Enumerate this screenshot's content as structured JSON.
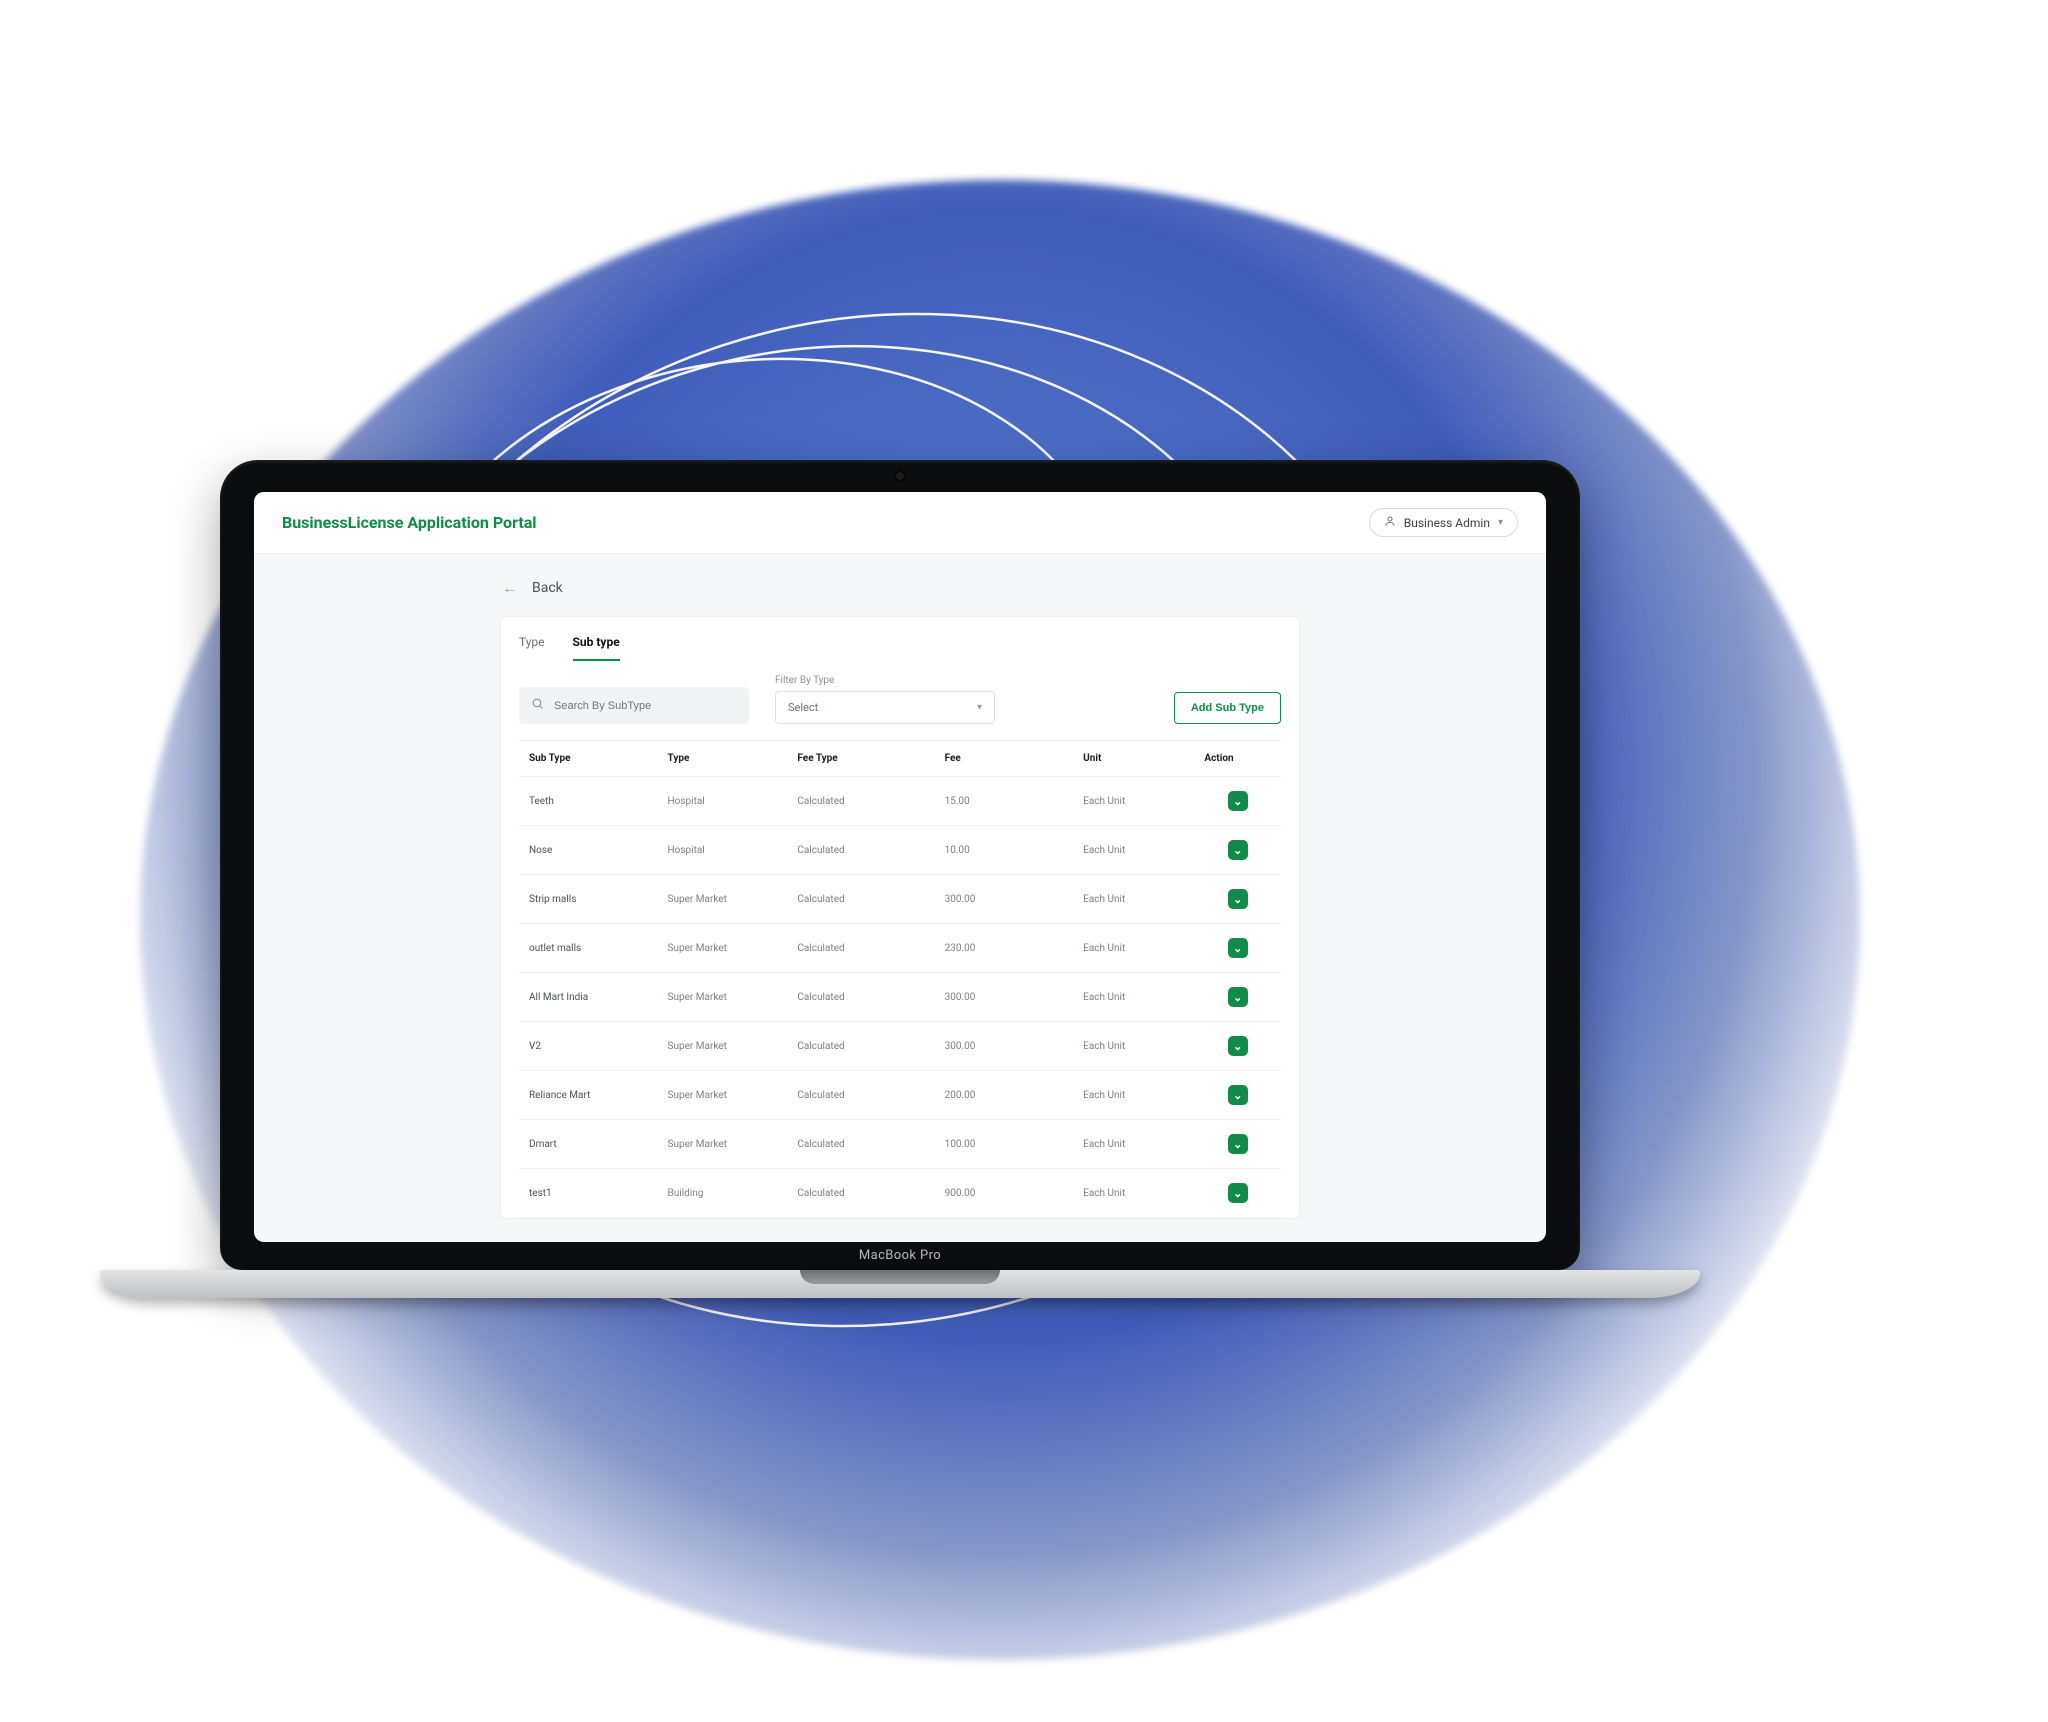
{
  "header": {
    "app_title": "BusinessLicense Application Portal",
    "user_label": "Business Admin"
  },
  "back_label": "Back",
  "tabs": {
    "type": "Type",
    "sub_type": "Sub type"
  },
  "search": {
    "placeholder": "Search By SubType"
  },
  "filter": {
    "label": "Filter By Type",
    "placeholder": "Select"
  },
  "add_button": "Add Sub Type",
  "columns": {
    "sub_type": "Sub Type",
    "type": "Type",
    "fee_type": "Fee Type",
    "fee": "Fee",
    "unit": "Unit",
    "action": "Action"
  },
  "rows": [
    {
      "sub_type": "Teeth",
      "type": "Hospital",
      "fee_type": "Calculated",
      "fee": "15.00",
      "unit": "Each Unit"
    },
    {
      "sub_type": "Nose",
      "type": "Hospital",
      "fee_type": "Calculated",
      "fee": "10.00",
      "unit": "Each Unit"
    },
    {
      "sub_type": "Strip malls",
      "type": "Super Market",
      "fee_type": "Calculated",
      "fee": "300.00",
      "unit": "Each Unit"
    },
    {
      "sub_type": "outlet malls",
      "type": "Super Market",
      "fee_type": "Calculated",
      "fee": "230.00",
      "unit": "Each Unit"
    },
    {
      "sub_type": "All Mart India",
      "type": "Super Market",
      "fee_type": "Calculated",
      "fee": "300.00",
      "unit": "Each Unit"
    },
    {
      "sub_type": "V2",
      "type": "Super Market",
      "fee_type": "Calculated",
      "fee": "300.00",
      "unit": "Each Unit"
    },
    {
      "sub_type": "Reliance Mart",
      "type": "Super Market",
      "fee_type": "Calculated",
      "fee": "200.00",
      "unit": "Each Unit"
    },
    {
      "sub_type": "Dmart",
      "type": "Super Market",
      "fee_type": "Calculated",
      "fee": "100.00",
      "unit": "Each Unit"
    },
    {
      "sub_type": "test1",
      "type": "Building",
      "fee_type": "Calculated",
      "fee": "900.00",
      "unit": "Each Unit"
    }
  ],
  "device_brand": "MacBook Pro"
}
